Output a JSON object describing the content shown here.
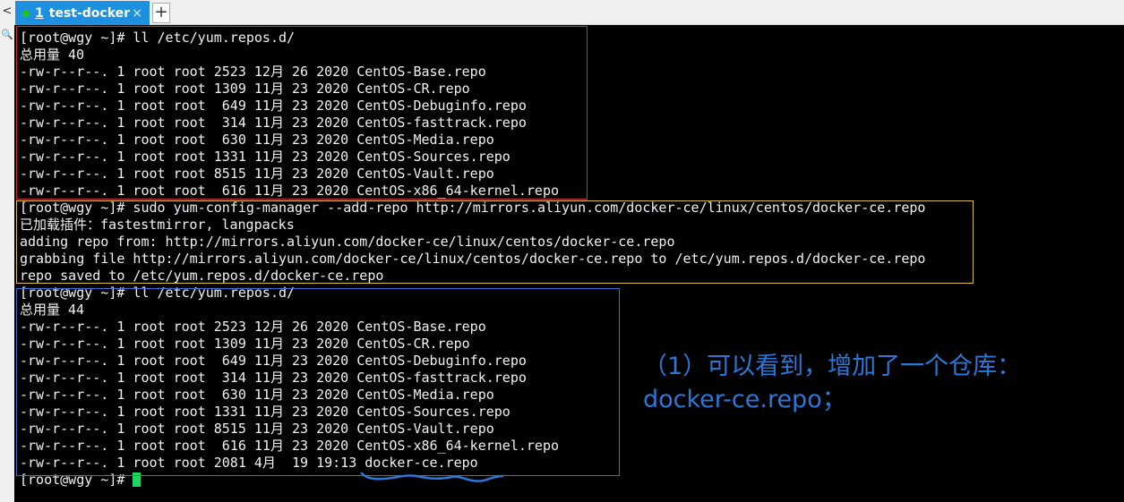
{
  "tab": {
    "number": "1",
    "title": "test-docker",
    "close": "×",
    "new_tab": "+"
  },
  "left_icons": [
    "<",
    "🔍"
  ],
  "terminal_lines": [
    "[root@wgy ~]# ll /etc/yum.repos.d/",
    "总用量 40",
    "-rw-r--r--. 1 root root 2523 12月 26 2020 CentOS-Base.repo",
    "-rw-r--r--. 1 root root 1309 11月 23 2020 CentOS-CR.repo",
    "-rw-r--r--. 1 root root  649 11月 23 2020 CentOS-Debuginfo.repo",
    "-rw-r--r--. 1 root root  314 11月 23 2020 CentOS-fasttrack.repo",
    "-rw-r--r--. 1 root root  630 11月 23 2020 CentOS-Media.repo",
    "-rw-r--r--. 1 root root 1331 11月 23 2020 CentOS-Sources.repo",
    "-rw-r--r--. 1 root root 8515 11月 23 2020 CentOS-Vault.repo",
    "-rw-r--r--. 1 root root  616 11月 23 2020 CentOS-x86_64-kernel.repo",
    "[root@wgy ~]# sudo yum-config-manager --add-repo http://mirrors.aliyun.com/docker-ce/linux/centos/docker-ce.repo",
    "已加载插件：fastestmirror, langpacks",
    "adding repo from: http://mirrors.aliyun.com/docker-ce/linux/centos/docker-ce.repo",
    "grabbing file http://mirrors.aliyun.com/docker-ce/linux/centos/docker-ce.repo to /etc/yum.repos.d/docker-ce.repo",
    "repo saved to /etc/yum.repos.d/docker-ce.repo",
    "[root@wgy ~]# ll /etc/yum.repos.d/",
    "总用量 44",
    "-rw-r--r--. 1 root root 2523 12月 26 2020 CentOS-Base.repo",
    "-rw-r--r--. 1 root root 1309 11月 23 2020 CentOS-CR.repo",
    "-rw-r--r--. 1 root root  649 11月 23 2020 CentOS-Debuginfo.repo",
    "-rw-r--r--. 1 root root  314 11月 23 2020 CentOS-fasttrack.repo",
    "-rw-r--r--. 1 root root  630 11月 23 2020 CentOS-Media.repo",
    "-rw-r--r--. 1 root root 1331 11月 23 2020 CentOS-Sources.repo",
    "-rw-r--r--. 1 root root 8515 11月 23 2020 CentOS-Vault.repo",
    "-rw-r--r--. 1 root root  616 11月 23 2020 CentOS-x86_64-kernel.repo",
    "-rw-r--r--. 1 root root 2081 4月  19 19:13 docker-ce.repo"
  ],
  "prompt": "[root@wgy ~]# ",
  "annotation": {
    "line1": "（1）可以看到，增加了一个仓库：",
    "line2": "docker-ce.repo；"
  },
  "colors": {
    "box1": "#d03030",
    "box2": "#e0c040",
    "box3": "#3a6fd8",
    "annotation": "#2a78d8",
    "cursor": "#1ed760"
  }
}
